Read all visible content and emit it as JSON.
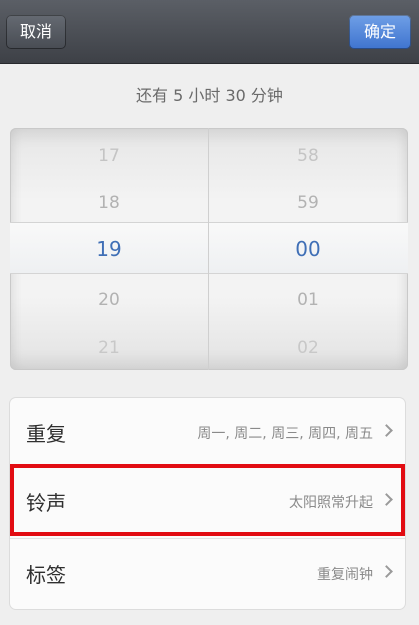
{
  "topbar": {
    "cancel_label": "取消",
    "confirm_label": "确定",
    "confirm_color": "#4a7fd6"
  },
  "remaining": "还有 5 小时 30 分钟",
  "picker": {
    "hours": [
      "17",
      "18",
      "19",
      "20",
      "21"
    ],
    "minutes": [
      "58",
      "59",
      "00",
      "01",
      "02"
    ],
    "selected_hour": "19",
    "selected_minute": "00",
    "selected_color": "#3f6fb6"
  },
  "settings": {
    "repeat": {
      "label": "重复",
      "value": "周一, 周二, 周三, 周四, 周五"
    },
    "sound": {
      "label": "铃声",
      "value": "太阳照常升起"
    },
    "tag": {
      "label": "标签",
      "value": "重复闹钟"
    }
  },
  "highlight_color": "#e20c12"
}
